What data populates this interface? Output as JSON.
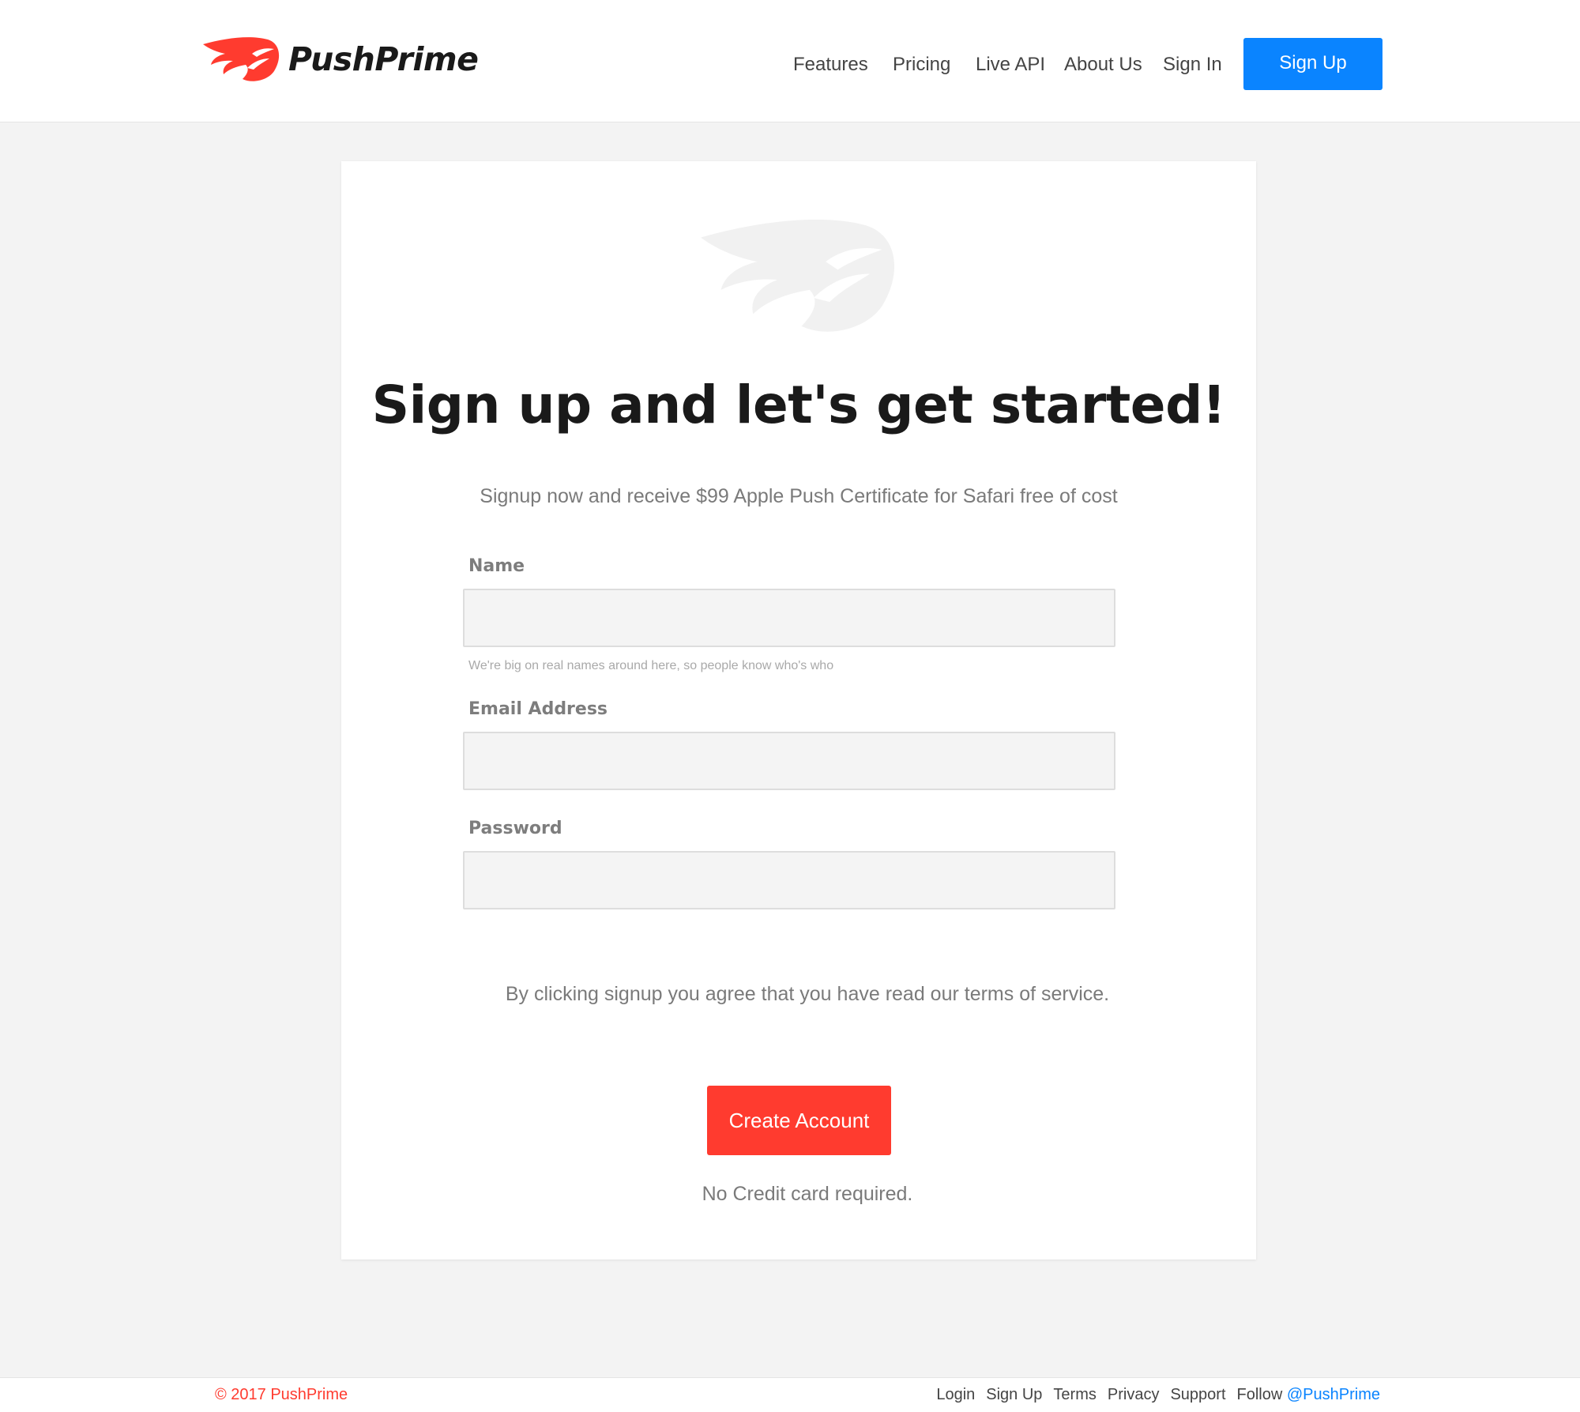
{
  "brand": {
    "name": "PushPrime",
    "logo_icon": "wing-logo-icon",
    "accent_color": "#ff3b2f",
    "primary_color": "#0a84ff"
  },
  "nav": {
    "items": [
      {
        "label": "Features"
      },
      {
        "label": "Pricing"
      },
      {
        "label": "Live API"
      },
      {
        "label": "About Us"
      },
      {
        "label": "Sign In"
      }
    ],
    "signup_label": "Sign Up"
  },
  "signup": {
    "title": "Sign up and let's get started!",
    "subtitle": "Signup now and receive $99 Apple Push Certificate for Safari free of cost",
    "fields": {
      "name": {
        "label": "Name",
        "value": "",
        "help": "We're big on real names around here, so people know who's who"
      },
      "email": {
        "label": "Email Address",
        "value": ""
      },
      "password": {
        "label": "Password",
        "value": ""
      }
    },
    "terms_text": "By clicking signup you agree that you have read our terms of service.",
    "submit_label": "Create Account",
    "note": "No Credit card required."
  },
  "footer": {
    "copyright": "© 2017 PushPrime",
    "links": [
      {
        "label": "Login"
      },
      {
        "label": "Sign Up"
      },
      {
        "label": "Terms"
      },
      {
        "label": "Privacy"
      },
      {
        "label": "Support"
      }
    ],
    "follow_prefix": "Follow ",
    "follow_handle": "@PushPrime"
  }
}
